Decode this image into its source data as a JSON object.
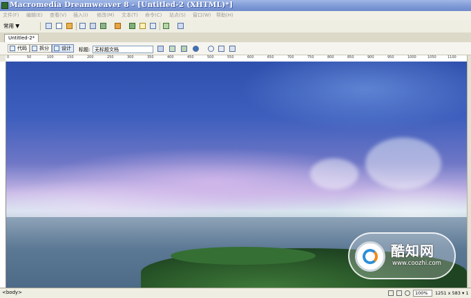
{
  "window": {
    "title": "Macromedia Dreamweaver 8 - [Untitled-2 (XHTML)*]"
  },
  "menu": {
    "items": [
      "文件(F)",
      "编辑(E)",
      "查看(V)",
      "插入(I)",
      "修改(M)",
      "文本(T)",
      "命令(C)",
      "站点(S)",
      "窗口(W)",
      "帮助(H)"
    ]
  },
  "insert_bar": {
    "category": "常用 ▼"
  },
  "document": {
    "tab_label": "Untitled-2*",
    "view_buttons": {
      "code": "代码",
      "split": "拆分",
      "design": "设计"
    },
    "title_label": "标题:",
    "title_value": "无标题文档"
  },
  "ruler": {
    "marks": [
      "0",
      "50",
      "100",
      "150",
      "200",
      "250",
      "300",
      "350",
      "400",
      "450",
      "500",
      "550",
      "600",
      "650",
      "700",
      "750",
      "800",
      "850",
      "900",
      "950",
      "1000",
      "1050",
      "1100"
    ]
  },
  "watermark": {
    "name": "酷知网",
    "url": "www.coozhi.com"
  },
  "status": {
    "tag_selector": "<body>",
    "zoom": "100%",
    "size": "1251 x 583 ▾ 1"
  },
  "icons": [
    "app-icon",
    "hyperlink-icon",
    "email-icon",
    "anchor-icon",
    "table-icon",
    "layer-icon",
    "image-icon",
    "media-icon",
    "date-icon",
    "comment-icon",
    "template-icon",
    "tag-chooser-icon",
    "refresh-icon",
    "view-options-icon",
    "visual-aids-icon",
    "browser-check-icon",
    "preview-icon",
    "select-tool-icon",
    "hand-tool-icon",
    "zoom-tool-icon"
  ]
}
